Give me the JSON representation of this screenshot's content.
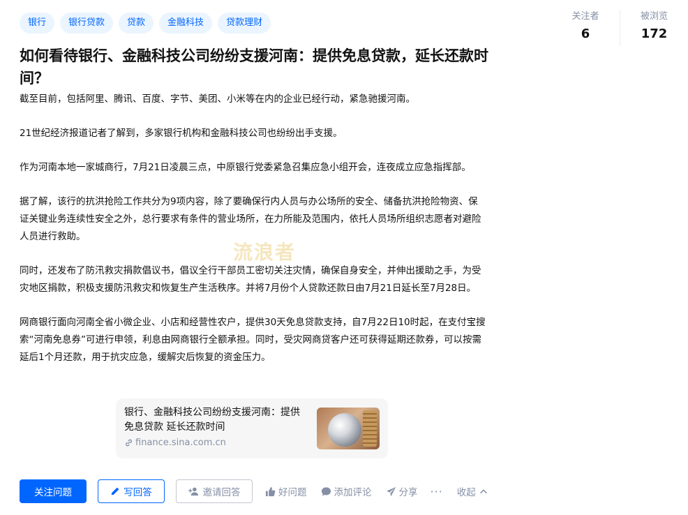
{
  "tags": [
    "银行",
    "银行贷款",
    "贷款",
    "金融科技",
    "贷款理财"
  ],
  "stats": {
    "followers_label": "关注者",
    "followers_value": "6",
    "views_label": "被浏览",
    "views_value": "172"
  },
  "question": {
    "title": "如何看待银行、金融科技公司纷纷支援河南：提供免息贷款，延长还款时间？",
    "paragraphs": [
      "截至目前，包括阿里、腾讯、百度、字节、美团、小米等在内的企业已经行动，紧急驰援河南。",
      "21世纪经济报道记者了解到，多家银行机构和金融科技公司也纷纷出手支援。",
      "作为河南本地一家城商行，7月21日凌晨三点，中原银行党委紧急召集应急小组开会，连夜成立应急指挥部。",
      "据了解，该行的抗洪抢险工作共分为9项内容，除了要确保行内人员与办公场所的安全、储备抗洪抢险物资、保证关键业务连续性安全之外，总行要求有条件的营业场所，在力所能及范围内，依托人员场所组织志愿者对避险人员进行救助。",
      "同时，还发布了防汛救灾捐款倡议书，倡议全行干部员工密切关注灾情，确保自身安全，并伸出援助之手，为受灾地区捐款，积极支援防汛救灾和恢复生产生活秩序。并将7月份个人贷款还款日由7月21日延长至7月28日。",
      "网商银行面向河南全省小微企业、小店和经营性农户，提供30天免息贷款支持，自7月22日10时起，在支付宝搜索“河南免息券”可进行申领，利息由网商银行全额承担。同时，受灾网商贷客户还可获得延期还款券，可以按需延后1个月还款，用于抗灾应急，缓解灾后恢复的资金压力。"
    ]
  },
  "watermark": "流浪者",
  "link_card": {
    "title": "银行、金融科技公司纷纷支援河南：提供免息贷款 延长还款时间",
    "url": "finance.sina.com.cn"
  },
  "actions": {
    "follow": "关注问题",
    "write_answer": "写回答",
    "invite": "邀请回答",
    "good_question": "好问题",
    "add_comment": "添加评论",
    "share": "分享",
    "more": "···",
    "collapse": "收起"
  },
  "colors": {
    "accent": "#0066ff",
    "tag_bg": "#ebf5ff",
    "muted": "#8590a6"
  }
}
